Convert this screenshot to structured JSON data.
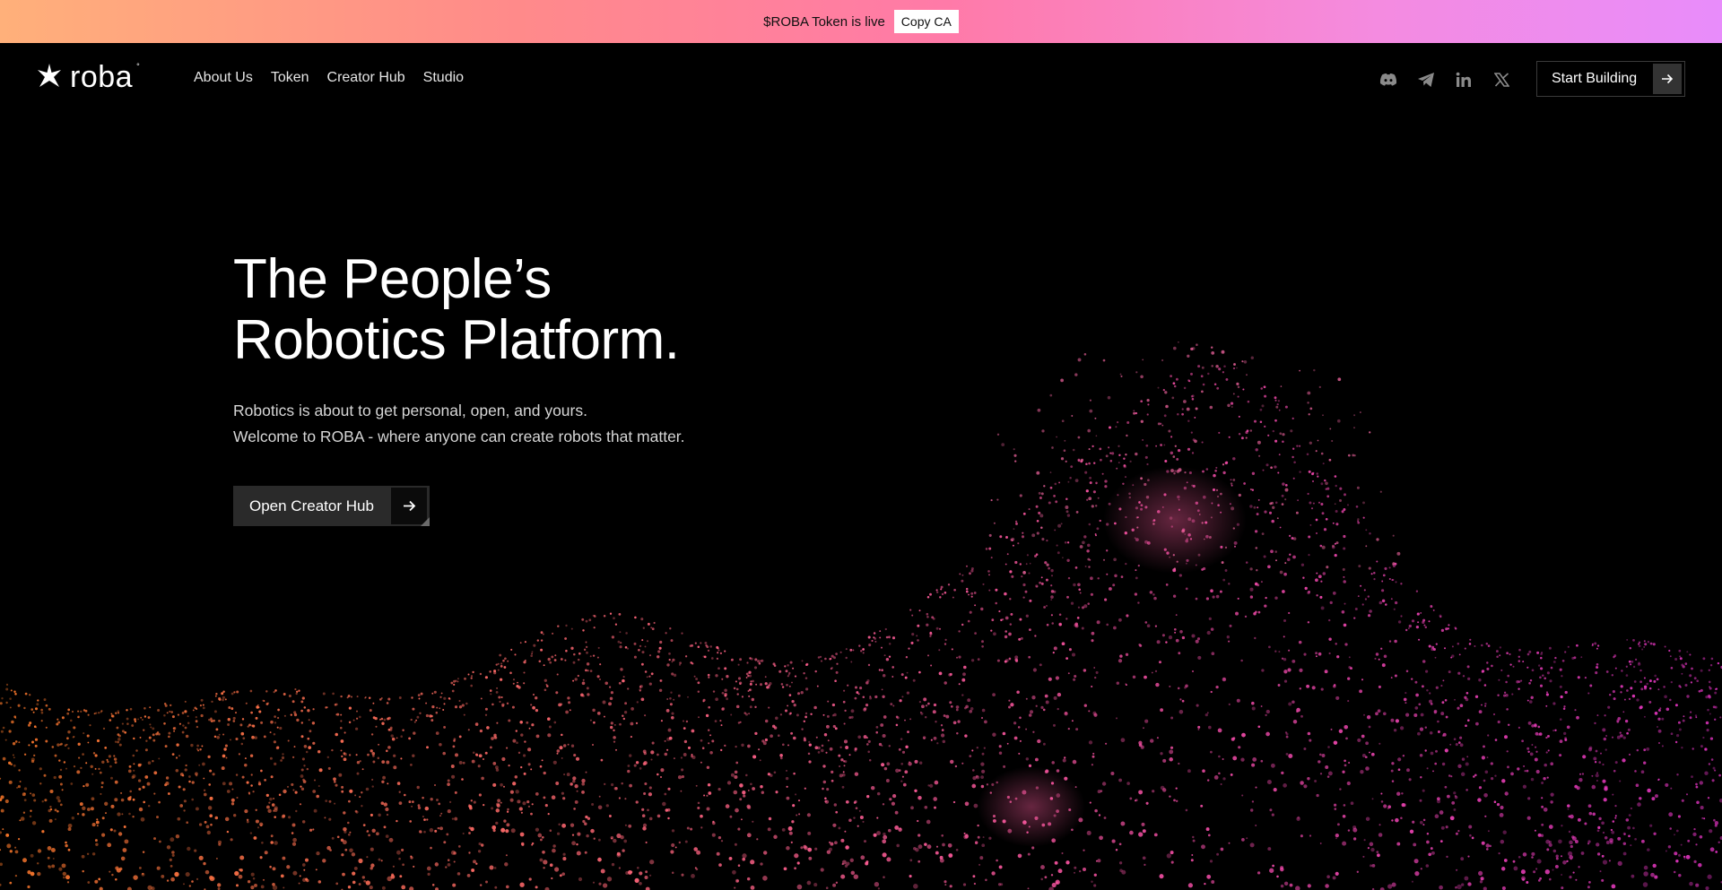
{
  "banner": {
    "text": "$ROBA Token is live",
    "copy_label": "Copy CA"
  },
  "logo": {
    "text": "roba",
    "reg": "°"
  },
  "nav": {
    "links": [
      "About Us",
      "Token",
      "Creator Hub",
      "Studio"
    ],
    "socials": [
      "discord-icon",
      "telegram-icon",
      "linkedin-icon",
      "x-icon"
    ],
    "cta_label": "Start Building"
  },
  "hero": {
    "title_line1": "The People’s",
    "title_line2": "Robotics Platform.",
    "subtitle_line1": "Robotics is about to get personal, open, and yours.",
    "subtitle_line2": "Welcome to ROBA - where anyone can create robots that matter.",
    "cta_label": "Open Creator Hub"
  },
  "colors": {
    "orange": "#ff7a2a",
    "pink": "#ff5ea0",
    "magenta": "#e63fc0"
  }
}
